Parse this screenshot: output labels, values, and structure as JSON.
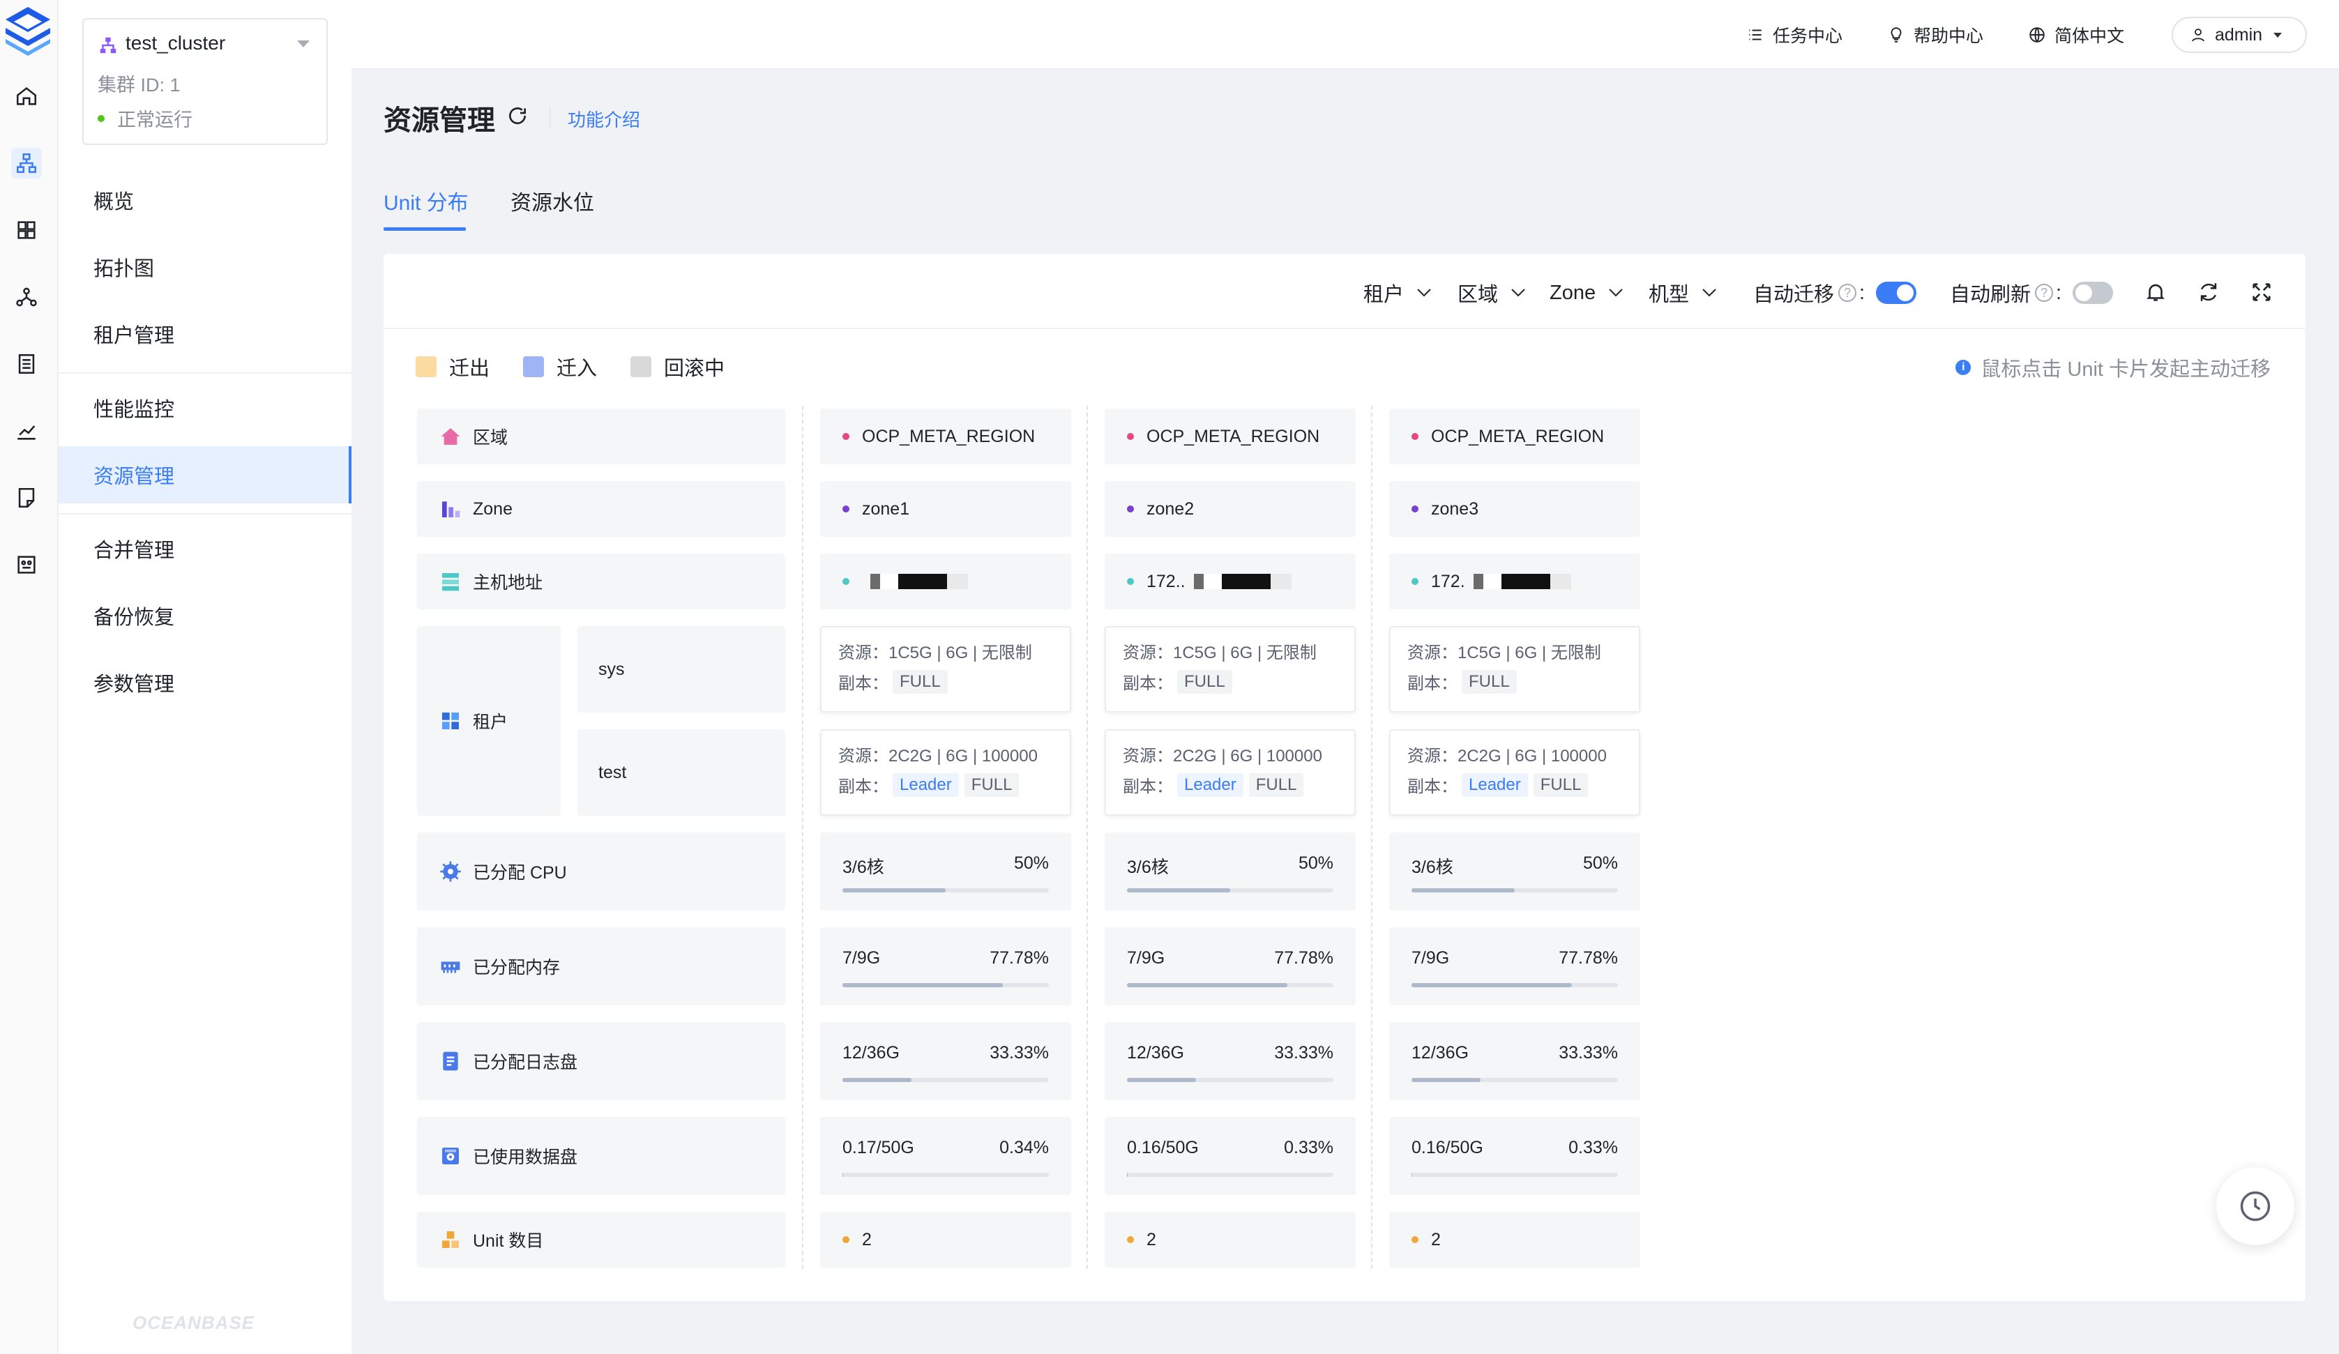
{
  "rail": {
    "icons": [
      "logo",
      "home-icon",
      "cluster-icon",
      "grid-icon",
      "topology-icon",
      "list-icon",
      "chart-icon",
      "note-icon",
      "panel-icon"
    ]
  },
  "cluster": {
    "name": "test_cluster",
    "id_text": "集群 ID: 1",
    "status": "正常运行",
    "status_color": "#52c41a"
  },
  "nav": {
    "items": [
      {
        "label": "概览"
      },
      {
        "label": "拓扑图"
      },
      {
        "label": "租户管理"
      },
      {
        "label": "性能监控"
      },
      {
        "label": "资源管理",
        "active": true
      },
      {
        "label": "合并管理"
      },
      {
        "label": "备份恢复"
      },
      {
        "label": "参数管理"
      }
    ],
    "brand": "OCEANBASE"
  },
  "header": {
    "tasks": "任务中心",
    "help": "帮助中心",
    "language": "简体中文",
    "user": "admin"
  },
  "page": {
    "title": "资源管理",
    "intro_link": "功能介绍",
    "tabs": [
      "Unit 分布",
      "资源水位"
    ],
    "active_tab": 0
  },
  "filters": {
    "tenant": "租户",
    "region": "区域",
    "zone": "Zone",
    "model": "机型",
    "auto_migrate": "自动迁移",
    "auto_migrate_on": true,
    "auto_refresh": "自动刷新",
    "auto_refresh_on": false
  },
  "legend": {
    "out": {
      "label": "迁出",
      "color": "#fbdba0"
    },
    "in": {
      "label": "迁入",
      "color": "#9fb4f5"
    },
    "rollback": {
      "label": "回滚中",
      "color": "#d9d9d9"
    }
  },
  "hint": "鼠标点击 Unit 卡片发起主动迁移",
  "row_labels": {
    "region": "区域",
    "zone": "Zone",
    "host": "主机地址",
    "tenant": "租户",
    "cpu": "已分配 CPU",
    "memory": "已分配内存",
    "log_disk": "已分配日志盘",
    "data_disk": "已使用数据盘",
    "unit_count": "Unit 数目"
  },
  "tenants": [
    "sys",
    "test"
  ],
  "labels": {
    "resource": "资源：",
    "replica": "副本："
  },
  "zones": [
    {
      "region": "OCP_META_REGION",
      "zone": "zone1",
      "host": "",
      "sys": {
        "resource": "1C5G | 6G | 无限制",
        "tags": [
          "FULL"
        ]
      },
      "test": {
        "resource": "2C2G | 6G | 100000",
        "tags": [
          "Leader",
          "FULL"
        ]
      },
      "cpu": {
        "value": "3/6核",
        "pct": "50%",
        "ratio": 0.5
      },
      "memory": {
        "value": "7/9G",
        "pct": "77.78%",
        "ratio": 0.7778
      },
      "log_disk": {
        "value": "12/36G",
        "pct": "33.33%",
        "ratio": 0.3333
      },
      "data_disk": {
        "value": "0.17/50G",
        "pct": "0.34%",
        "ratio": 0.0034
      },
      "unit_count": "2"
    },
    {
      "region": "OCP_META_REGION",
      "zone": "zone2",
      "host": "172..",
      "sys": {
        "resource": "1C5G | 6G | 无限制",
        "tags": [
          "FULL"
        ]
      },
      "test": {
        "resource": "2C2G | 6G | 100000",
        "tags": [
          "Leader",
          "FULL"
        ]
      },
      "cpu": {
        "value": "3/6核",
        "pct": "50%",
        "ratio": 0.5
      },
      "memory": {
        "value": "7/9G",
        "pct": "77.78%",
        "ratio": 0.7778
      },
      "log_disk": {
        "value": "12/36G",
        "pct": "33.33%",
        "ratio": 0.3333
      },
      "data_disk": {
        "value": "0.16/50G",
        "pct": "0.33%",
        "ratio": 0.0033
      },
      "unit_count": "2"
    },
    {
      "region": "OCP_META_REGION",
      "zone": "zone3",
      "host": "172.",
      "sys": {
        "resource": "1C5G | 6G | 无限制",
        "tags": [
          "FULL"
        ]
      },
      "test": {
        "resource": "2C2G | 6G | 100000",
        "tags": [
          "Leader",
          "FULL"
        ]
      },
      "cpu": {
        "value": "3/6核",
        "pct": "50%",
        "ratio": 0.5
      },
      "memory": {
        "value": "7/9G",
        "pct": "77.78%",
        "ratio": 0.7778
      },
      "log_disk": {
        "value": "12/36G",
        "pct": "33.33%",
        "ratio": 0.3333
      },
      "data_disk": {
        "value": "0.16/50G",
        "pct": "0.33%",
        "ratio": 0.0033
      },
      "unit_count": "2"
    }
  ],
  "colors": {
    "accent": "#3a7df6",
    "region_dot": "#e8477f",
    "zone_dot": "#7b3fd6",
    "host_dot": "#4fc7c7",
    "unit_dot": "#f0a73a"
  }
}
